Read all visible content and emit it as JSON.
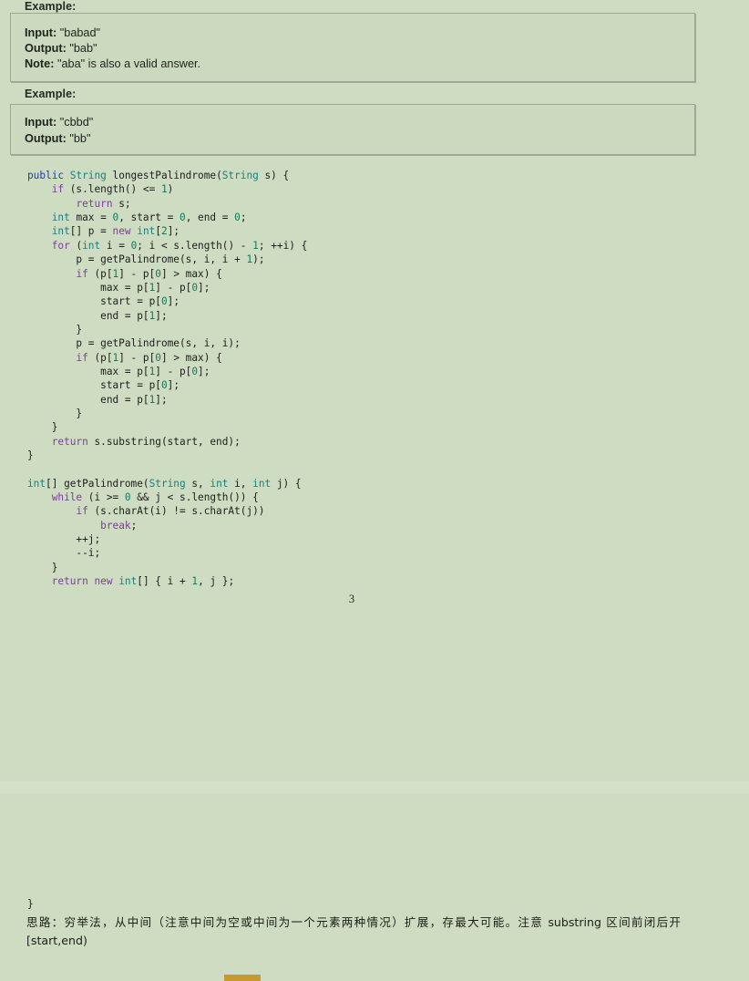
{
  "document": {
    "page_number": "3",
    "background_color": "#cedcc1",
    "accent_color": "#c8992f"
  },
  "examples": [
    {
      "heading": "Example:",
      "lines": [
        {
          "label": "Input:",
          "value": " \"babad\""
        },
        {
          "label": "Output:",
          "value": " \"bab\""
        },
        {
          "label": "Note:",
          "value": " \"aba\" is also a valid answer."
        }
      ]
    },
    {
      "heading": "Example:",
      "lines": [
        {
          "label": "Input:",
          "value": " \"cbbd\""
        },
        {
          "label": "Output:",
          "value": " \"bb\""
        }
      ]
    }
  ],
  "code": {
    "language": "java",
    "text": "public String longestPalindrome(String s) {\n    if (s.length() <= 1)\n        return s;\n    int max = 0, start = 0, end = 0;\n    int[] p = new int[2];\n    for (int i = 0; i < s.length() - 1; ++i) {\n        p = getPalindrome(s, i, i + 1);\n        if (p[1] - p[0] > max) {\n            max = p[1] - p[0];\n            start = p[0];\n            end = p[1];\n        }\n        p = getPalindrome(s, i, i);\n        if (p[1] - p[0] > max) {\n            max = p[1] - p[0];\n            start = p[0];\n            end = p[1];\n        }\n    }\n    return s.substring(start, end);\n}\n\nint[] getPalindrome(String s, int i, int j) {\n    while (i >= 0 && j < s.length()) {\n        if (s.charAt(i) != s.charAt(j))\n            break;\n        ++j;\n        --i;\n    }\n    return new int[] { i + 1, j };",
    "tokens": {
      "modifiers": [
        "public"
      ],
      "types": [
        "String",
        "int"
      ],
      "keywords": [
        "if",
        "return",
        "for",
        "while",
        "new",
        "break"
      ],
      "numbers": [
        "0",
        "1",
        "2"
      ]
    },
    "colors": {
      "modifier": "#1f3f9e",
      "type": "#1a7f7f",
      "keyword": "#7a3e9d",
      "number": "#12795f",
      "plain": "#1d1d1d"
    }
  },
  "closing_brace": "}",
  "note": "思路：穷举法，从中间（注意中间为空或中间为一个元素两种情况）扩展，存最大可能。注意 substring 区间前闭后开[start,end)"
}
